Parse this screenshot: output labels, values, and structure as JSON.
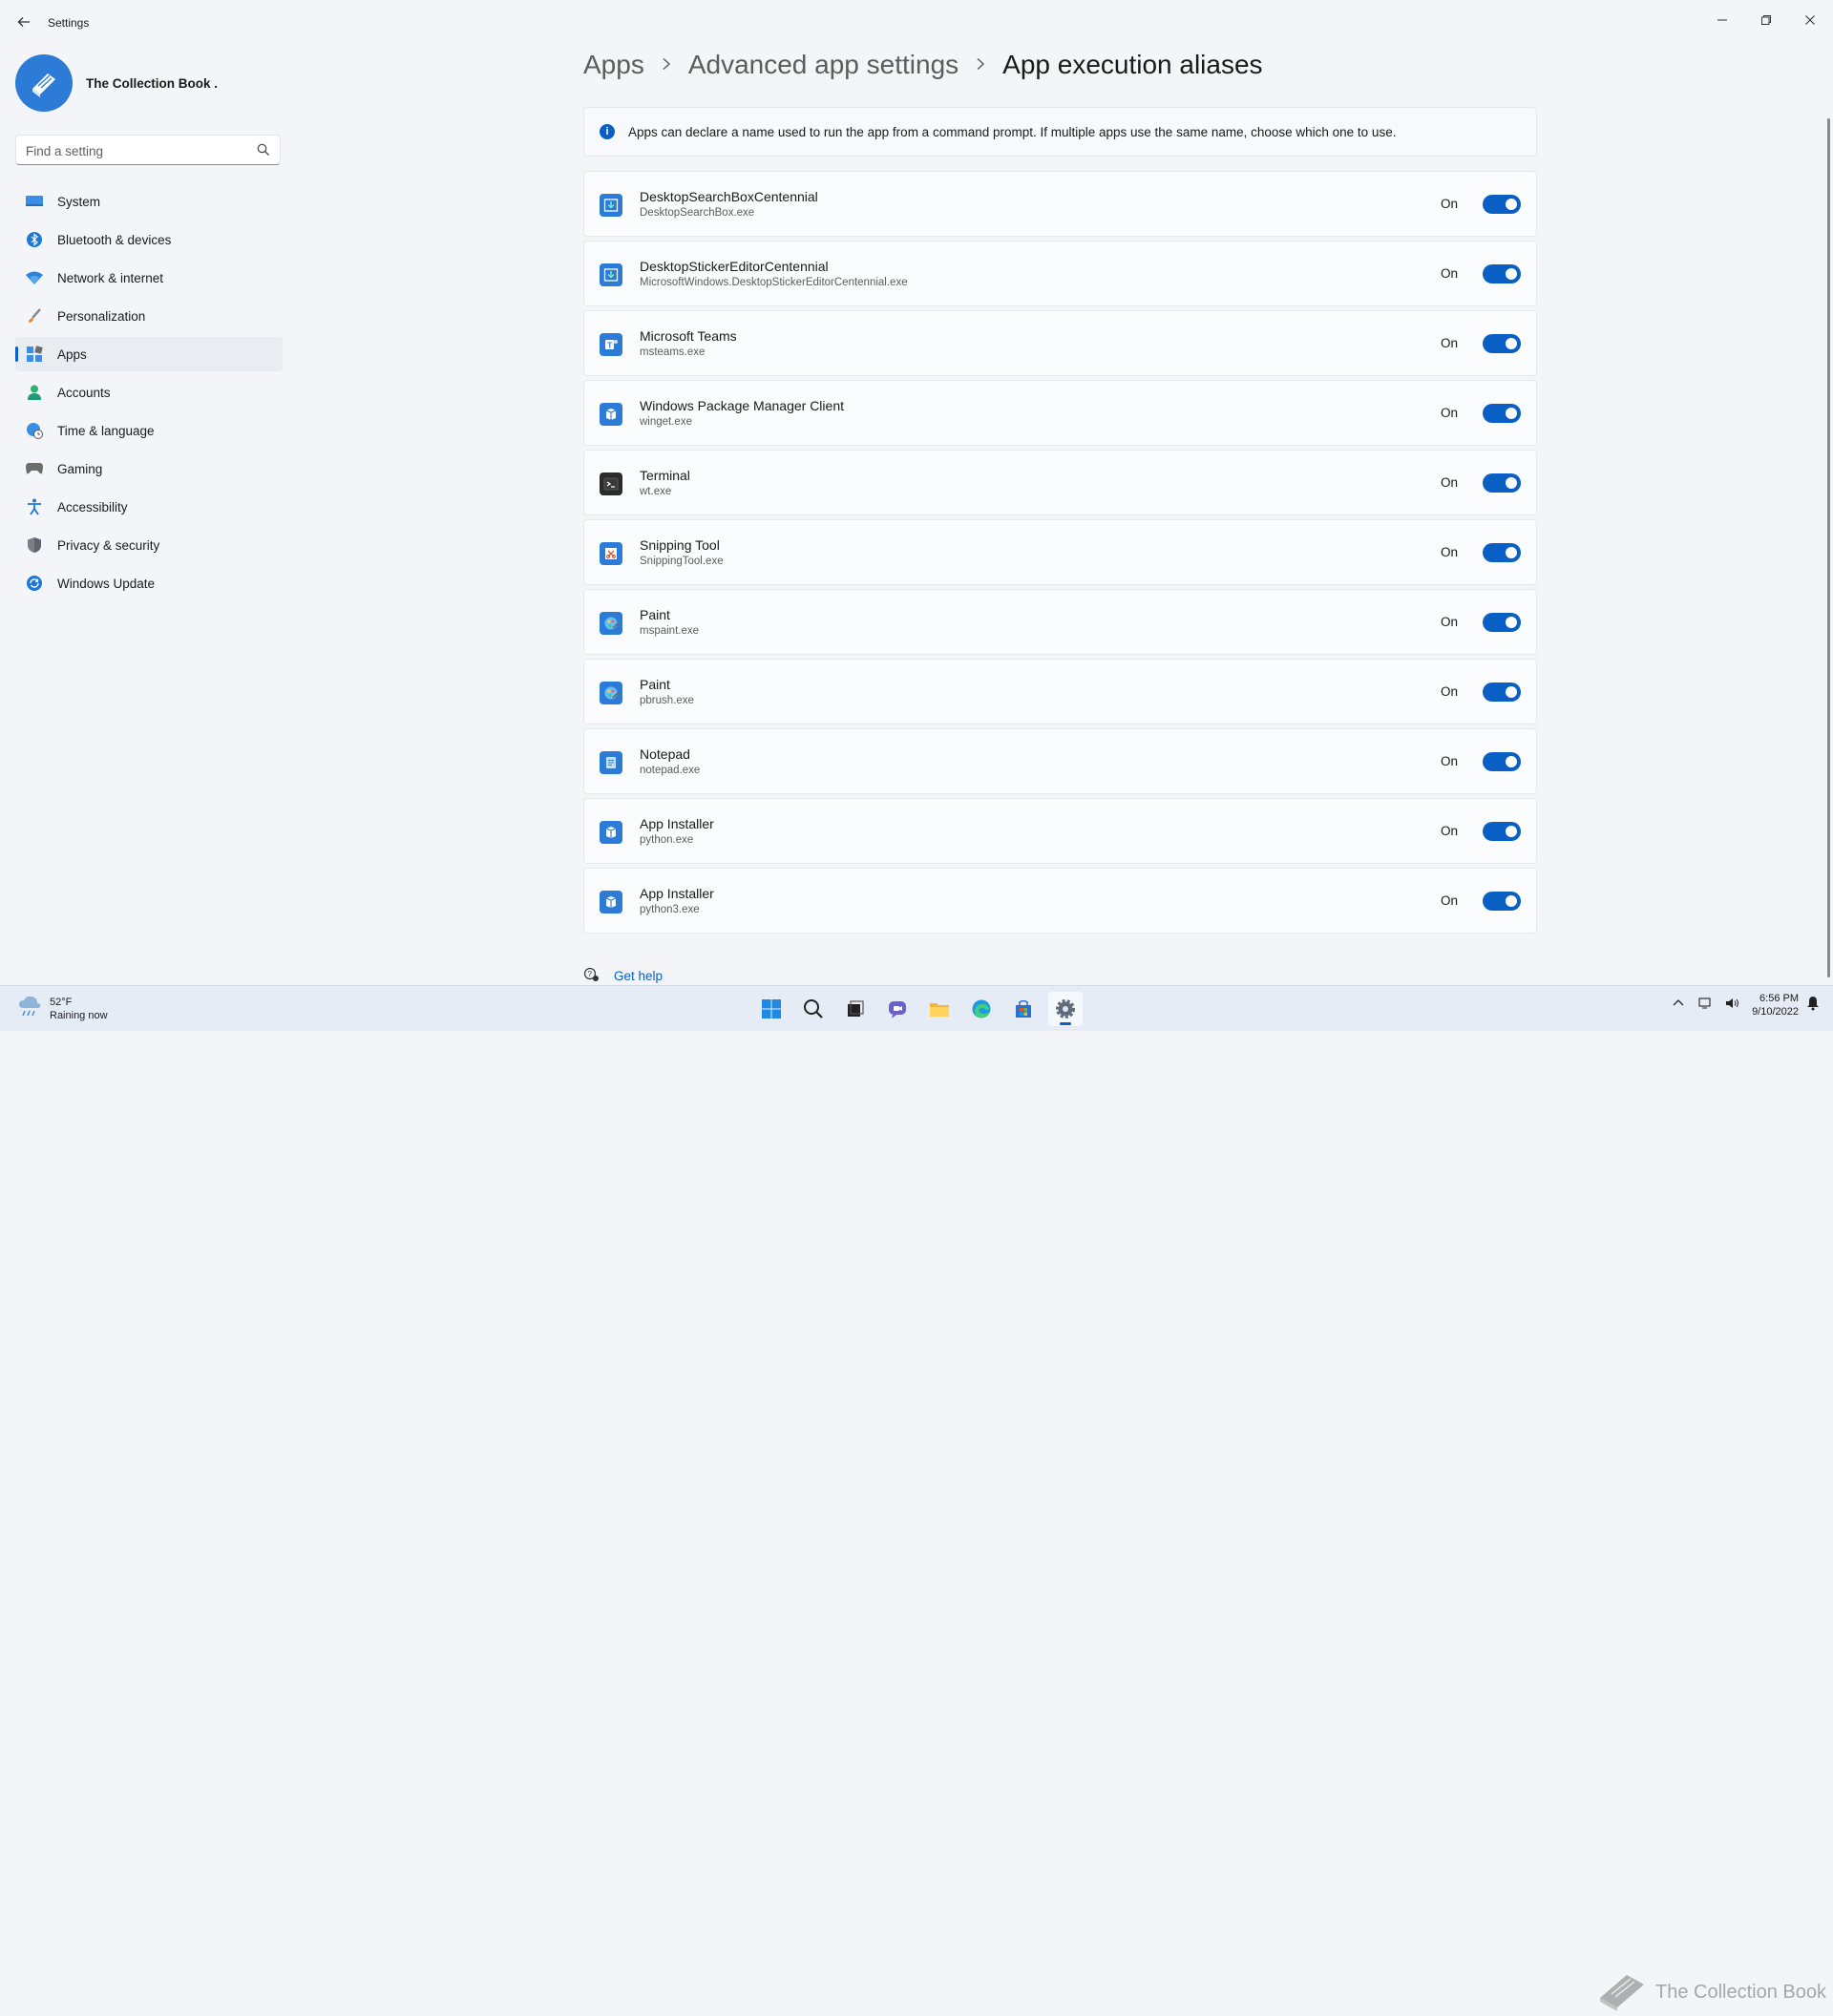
{
  "window": {
    "title": "Settings",
    "back_icon": "back-arrow-icon",
    "controls": [
      "minimize-icon",
      "restore-icon",
      "close-icon"
    ]
  },
  "profile": {
    "name": "The Collection Book ."
  },
  "search": {
    "placeholder": "Find a setting"
  },
  "sidebar": {
    "items": [
      {
        "label": "System",
        "icon": "monitor-icon"
      },
      {
        "label": "Bluetooth & devices",
        "icon": "bluetooth-icon"
      },
      {
        "label": "Network & internet",
        "icon": "wifi-icon"
      },
      {
        "label": "Personalization",
        "icon": "brush-icon"
      },
      {
        "label": "Apps",
        "icon": "apps-icon",
        "active": true
      },
      {
        "label": "Accounts",
        "icon": "person-icon"
      },
      {
        "label": "Time & language",
        "icon": "globe-clock-icon"
      },
      {
        "label": "Gaming",
        "icon": "gamepad-icon"
      },
      {
        "label": "Accessibility",
        "icon": "accessibility-icon"
      },
      {
        "label": "Privacy & security",
        "icon": "shield-icon"
      },
      {
        "label": "Windows Update",
        "icon": "update-icon"
      }
    ]
  },
  "breadcrumb": {
    "items": [
      "Apps",
      "Advanced app settings"
    ],
    "current": "App execution aliases"
  },
  "info": {
    "text": "Apps can declare a name used to run the app from a command prompt. If multiple apps use the same name, choose which one to use."
  },
  "aliases": [
    {
      "name": "DesktopSearchBoxCentennial",
      "exe": "DesktopSearchBox.exe",
      "state": "On"
    },
    {
      "name": "DesktopStickerEditorCentennial",
      "exe": "MicrosoftWindows.DesktopStickerEditorCentennial.exe",
      "state": "On"
    },
    {
      "name": "Microsoft Teams",
      "exe": "msteams.exe",
      "state": "On"
    },
    {
      "name": "Windows Package Manager Client",
      "exe": "winget.exe",
      "state": "On"
    },
    {
      "name": "Terminal",
      "exe": "wt.exe",
      "state": "On"
    },
    {
      "name": "Snipping Tool",
      "exe": "SnippingTool.exe",
      "state": "On"
    },
    {
      "name": "Paint",
      "exe": "mspaint.exe",
      "state": "On"
    },
    {
      "name": "Paint",
      "exe": "pbrush.exe",
      "state": "On"
    },
    {
      "name": "Notepad",
      "exe": "notepad.exe",
      "state": "On"
    },
    {
      "name": "App Installer",
      "exe": "python.exe",
      "state": "On"
    },
    {
      "name": "App Installer",
      "exe": "python3.exe",
      "state": "On"
    }
  ],
  "help": {
    "label": "Get help"
  },
  "taskbar": {
    "weather_temp": "52°F",
    "weather_desc": "Raining now",
    "time": "6:56 PM",
    "date": "9/10/2022",
    "watermark": "The Collection Book"
  },
  "colors": {
    "accent": "#0a5fc4",
    "background": "#f3f5f9"
  }
}
